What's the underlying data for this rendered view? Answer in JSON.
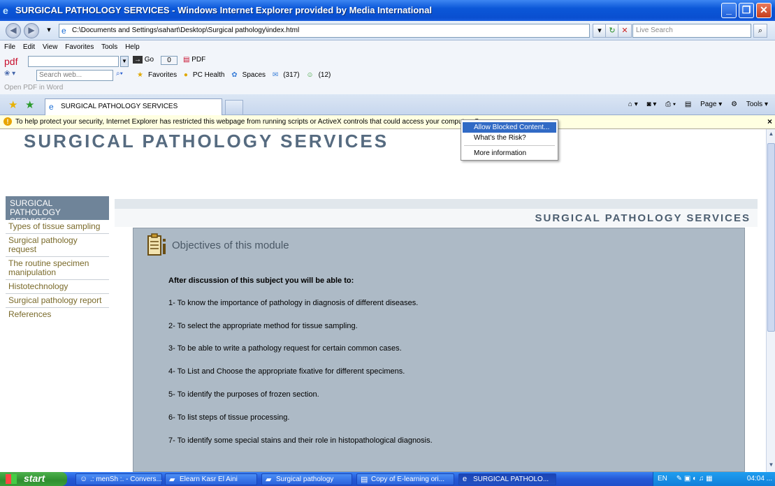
{
  "window": {
    "title": "SURGICAL PATHOLOGY SERVICES - Windows Internet Explorer provided by Media International"
  },
  "address": {
    "url": "C:\\Documents and Settings\\sahart\\Desktop\\Surgical pathology\\index.html",
    "search_placeholder": "Live Search"
  },
  "menu": [
    "File",
    "Edit",
    "View",
    "Favorites",
    "Tools",
    "Help"
  ],
  "pdfbar": {
    "label": "pdf",
    "go": "Go",
    "count": "0",
    "pdf": "PDF"
  },
  "toolbar": {
    "search_placeholder": "Search web...",
    "items": [
      "Favorites",
      "PC Health",
      "Spaces",
      "(317)",
      "(12)"
    ],
    "open_pdf": "Open PDF in Word"
  },
  "tab": {
    "label": "SURGICAL PATHOLOGY SERVICES"
  },
  "commands": {
    "page": "Page",
    "tools": "Tools"
  },
  "infobar": {
    "text": "To help protect your security, Internet Explorer has restricted this webpage from running scripts or ActiveX controls that could access your computer. C"
  },
  "popup": {
    "items": [
      "Allow Blocked Content...",
      "What's the Risk?",
      "More information"
    ]
  },
  "site": {
    "title": "SURGICAL PATHOLOGY SERVICES",
    "section_header": "SURGICAL PATHOLOGY SERVICES"
  },
  "sidebar": {
    "active": "SURGICAL PATHOLOGY SERVICES",
    "items": [
      "Types of tissue sampling",
      "Surgical pathology request",
      "The routine specimen manipulation",
      "Histotechnology",
      "Surgical pathology report",
      "References"
    ]
  },
  "module": {
    "heading": "Objectives of this module",
    "lead": "After discussion of this subject you will be able to:",
    "objectives": [
      "1- To know the importance of pathology in diagnosis of different diseases.",
      "2- To select the appropriate method for tissue sampling.",
      "3- To be able to write a pathology request for certain common cases.",
      "4- To List and Choose the appropriate fixative for different specimens.",
      "5- To identify the purposes of frozen section.",
      "6- To list steps of tissue processing.",
      "7- To identify some special stains and their role in histopathological diagnosis."
    ]
  },
  "taskbar": {
    "start": "start",
    "tasks": [
      ".: menSh :. - Convers...",
      "Elearn Kasr El Aini",
      "Surgical pathology",
      "Copy of E-learning ori...",
      "SURGICAL PATHOLO..."
    ],
    "lang": "EN",
    "clock": "04:04 ..."
  }
}
